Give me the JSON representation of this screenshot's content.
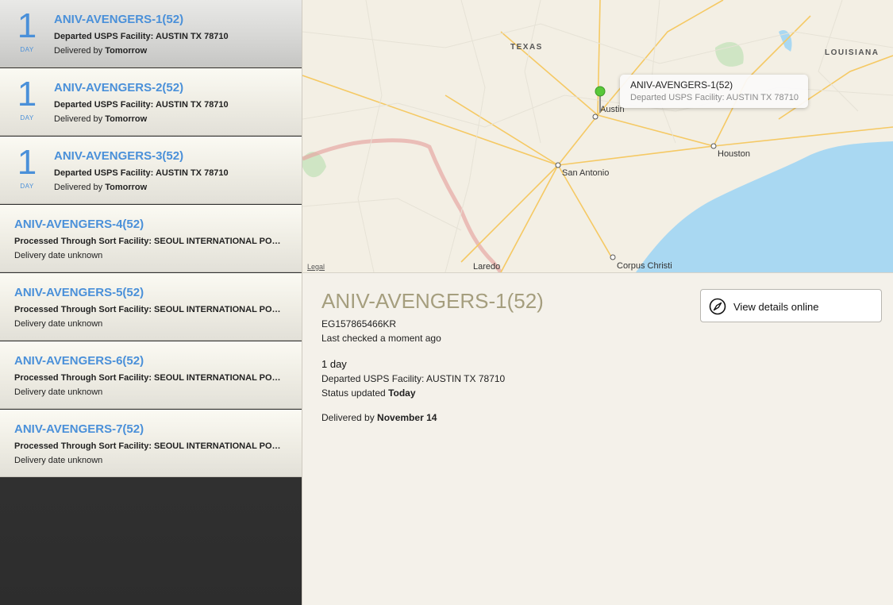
{
  "packages": [
    {
      "title": "ANIV-AVENGERS-1(52)",
      "days": "1",
      "days_unit": "DAY",
      "status": "Departed USPS Facility: AUSTIN TX 78710",
      "delivered_prefix": "Delivered by",
      "delivered_value": "Tomorrow"
    },
    {
      "title": "ANIV-AVENGERS-2(52)",
      "days": "1",
      "days_unit": "DAY",
      "status": "Departed USPS Facility: AUSTIN TX 78710",
      "delivered_prefix": "Delivered by",
      "delivered_value": "Tomorrow"
    },
    {
      "title": "ANIV-AVENGERS-3(52)",
      "days": "1",
      "days_unit": "DAY",
      "status": "Departed USPS Facility: AUSTIN TX 78710",
      "delivered_prefix": "Delivered by",
      "delivered_value": "Tomorrow"
    },
    {
      "title": "ANIV-AVENGERS-4(52)",
      "status": "Processed Through Sort Facility: SEOUL INTERNATIONAL POSTAL CENTER",
      "delivered_text": "Delivery date unknown"
    },
    {
      "title": "ANIV-AVENGERS-5(52)",
      "status": "Processed Through Sort Facility: SEOUL INTERNATIONAL POSTAL CENTER",
      "delivered_text": "Delivery date unknown"
    },
    {
      "title": "ANIV-AVENGERS-6(52)",
      "status": "Processed Through Sort Facility: SEOUL INTERNATIONAL POSTAL CENTER",
      "delivered_text": "Delivery date unknown"
    },
    {
      "title": "ANIV-AVENGERS-7(52)",
      "status": "Processed Through Sort Facility: SEOUL INTERNATIONAL POSTAL CENTER",
      "delivered_text": "Delivery date unknown"
    }
  ],
  "map": {
    "states": [
      "TEXAS",
      "LOUISIANA"
    ],
    "cities": [
      "Austin",
      "San Antonio",
      "Houston",
      "Laredo",
      "Corpus Christi"
    ],
    "legal": "Legal",
    "callout": {
      "title": "ANIV-AVENGERS-1(52)",
      "subtitle": "Departed USPS Facility: AUSTIN TX 78710"
    }
  },
  "detail": {
    "title": "ANIV-AVENGERS-1(52)",
    "tracking_number": "EG157865466KR",
    "last_checked": "Last checked a moment ago",
    "days": "1 day",
    "status": "Departed USPS Facility: AUSTIN TX 78710",
    "status_updated_prefix": "Status updated",
    "status_updated_value": "Today",
    "delivered_prefix": "Delivered by",
    "delivered_value": "November 14",
    "online_button": "View details online",
    "online_icon": "compass-icon"
  },
  "colors": {
    "accent": "#4a90d9",
    "detail_title": "#a59e7e",
    "pin": "#59c83a",
    "water": "#a9d8f2",
    "road": "#f5c964"
  }
}
